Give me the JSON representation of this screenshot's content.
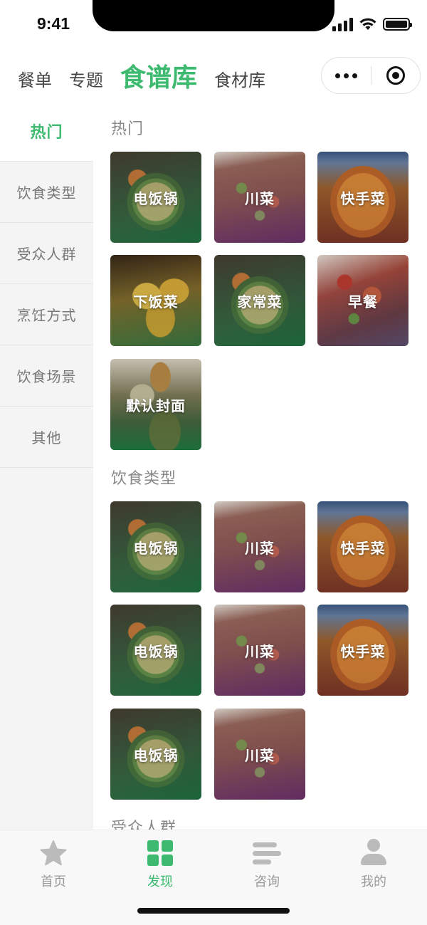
{
  "status_bar": {
    "time": "9:41"
  },
  "top_tabs": [
    {
      "label": "餐单",
      "active": false
    },
    {
      "label": "专题",
      "active": false
    },
    {
      "label": "食谱库",
      "active": true
    },
    {
      "label": "食材库",
      "active": false
    }
  ],
  "sidebar": {
    "items": [
      {
        "label": "热门",
        "active": true
      },
      {
        "label": "饮食类型",
        "active": false
      },
      {
        "label": "受众人群",
        "active": false
      },
      {
        "label": "烹饪方式",
        "active": false
      },
      {
        "label": "饮食场景",
        "active": false
      },
      {
        "label": "其他",
        "active": false
      }
    ]
  },
  "sections": [
    {
      "title": "热门",
      "tiles": [
        {
          "label": "电饭锅",
          "image": "rice-cooker-dish"
        },
        {
          "label": "川菜",
          "image": "sichuan-dish"
        },
        {
          "label": "快手菜",
          "image": "quick-dish"
        },
        {
          "label": "下饭菜",
          "image": "rice-side-dish"
        },
        {
          "label": "家常菜",
          "image": "home-style-dish"
        },
        {
          "label": "早餐",
          "image": "breakfast-dish"
        },
        {
          "label": "默认封面",
          "image": "default-cover"
        }
      ]
    },
    {
      "title": "饮食类型",
      "tiles": [
        {
          "label": "电饭锅",
          "image": "rice-cooker-dish"
        },
        {
          "label": "川菜",
          "image": "sichuan-dish"
        },
        {
          "label": "快手菜",
          "image": "quick-dish"
        },
        {
          "label": "电饭锅",
          "image": "rice-cooker-dish"
        },
        {
          "label": "川菜",
          "image": "sichuan-dish"
        },
        {
          "label": "快手菜",
          "image": "quick-dish"
        },
        {
          "label": "电饭锅",
          "image": "rice-cooker-dish"
        },
        {
          "label": "川菜",
          "image": "sichuan-dish"
        }
      ]
    },
    {
      "title": "受众人群",
      "tiles": []
    }
  ],
  "tabbar": [
    {
      "label": "首页",
      "icon": "star-icon",
      "active": false
    },
    {
      "label": "发现",
      "icon": "grid-icon",
      "active": true
    },
    {
      "label": "咨询",
      "icon": "lines-icon",
      "active": false
    },
    {
      "label": "我的",
      "icon": "person-icon",
      "active": false
    }
  ],
  "colors": {
    "accent": "#3dba6f",
    "sidebar_bg": "#f4f4f4",
    "inactive": "#999999"
  }
}
